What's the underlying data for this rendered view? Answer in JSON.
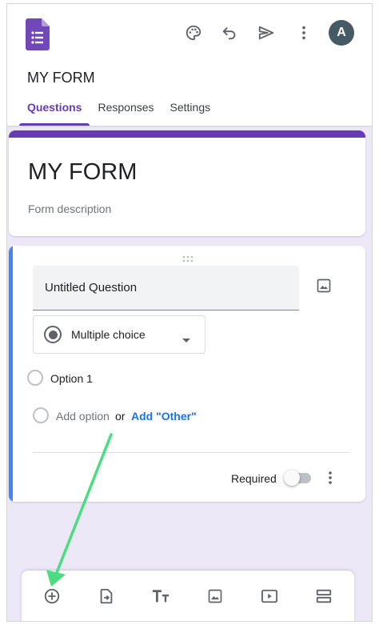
{
  "header": {
    "doc_title": "MY FORM",
    "avatar_initial": "A",
    "icons": [
      "palette-icon",
      "undo-icon",
      "send-icon",
      "more-vert-icon"
    ],
    "tabs": [
      {
        "label": "Questions",
        "active": true
      },
      {
        "label": "Responses",
        "active": false
      },
      {
        "label": "Settings",
        "active": false
      }
    ]
  },
  "form": {
    "title": "MY FORM",
    "description_placeholder": "Form description"
  },
  "question": {
    "title": "Untitled Question",
    "type": "Multiple choice",
    "options": [
      "Option 1"
    ],
    "add_option": "Add option",
    "or": "or",
    "add_other": "Add \"Other\"",
    "required_label": "Required",
    "required": false
  },
  "toolbar": {
    "buttons": [
      "add-question-icon",
      "import-questions-icon",
      "add-title-icon",
      "add-image-icon",
      "add-video-icon",
      "add-section-icon"
    ]
  },
  "colors": {
    "accent": "#673ab7",
    "active_card": "#4285f4",
    "background": "#ece8f7",
    "annotation_arrow": "#4ade80",
    "link": "#1a73e8"
  }
}
